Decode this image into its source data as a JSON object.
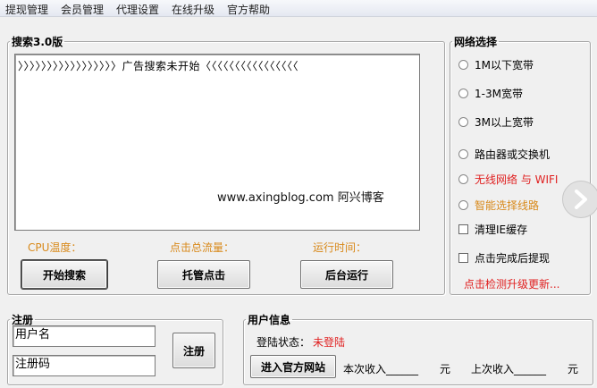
{
  "menu": [
    "提现管理",
    "会员管理",
    "代理设置",
    "在线升级",
    "官方帮助"
  ],
  "search": {
    "legend": "搜索3.0版",
    "log_text": "〉〉〉〉〉〉〉〉〉〉〉〉〉〉〉〉〉广告搜索未开始〈〈〈〈〈〈〈〈〈〈〈〈〈〈〈〈",
    "watermark": "www.axingblog.com 阿兴博客",
    "cpu_label": "CPU温度：",
    "click_label": "点击总流量：",
    "runtime_label": "运行时间：",
    "start_button": "开始搜索",
    "auto_click_button": "托管点击",
    "background_button": "后台运行"
  },
  "network": {
    "legend": "网络选择",
    "options": [
      {
        "label": "1M以下宽带",
        "type": "radio"
      },
      {
        "label": "1-3M宽带",
        "type": "radio"
      },
      {
        "label": "3M以上宽带",
        "type": "radio"
      },
      {
        "label": "路由器或交换机",
        "type": "radio"
      },
      {
        "label": "无线网络 与 WIFI",
        "type": "radio",
        "color": "#e02020"
      },
      {
        "label": "智能选择线路",
        "type": "radio",
        "color": "#d8891a"
      },
      {
        "label": "清理IE缓存",
        "type": "checkbox"
      },
      {
        "label": "点击完成后提现",
        "type": "checkbox"
      }
    ],
    "update_link": "点击检测升级更新..."
  },
  "register": {
    "legend": "注册",
    "username_value": "用户名",
    "regcode_value": "注册码",
    "register_button": "注册"
  },
  "user_info": {
    "legend": "用户信息",
    "login_label": "登陆状态：",
    "login_status": "未登陆",
    "official_site_button": "进入官方网站",
    "this_income": "本次收入______　　元",
    "last_income": "上次收入______　　元"
  },
  "colors": {
    "accent_orange": "#d8891a",
    "accent_red": "#e02020"
  },
  "icons": {
    "side_arrow": "chevron-right-icon"
  }
}
